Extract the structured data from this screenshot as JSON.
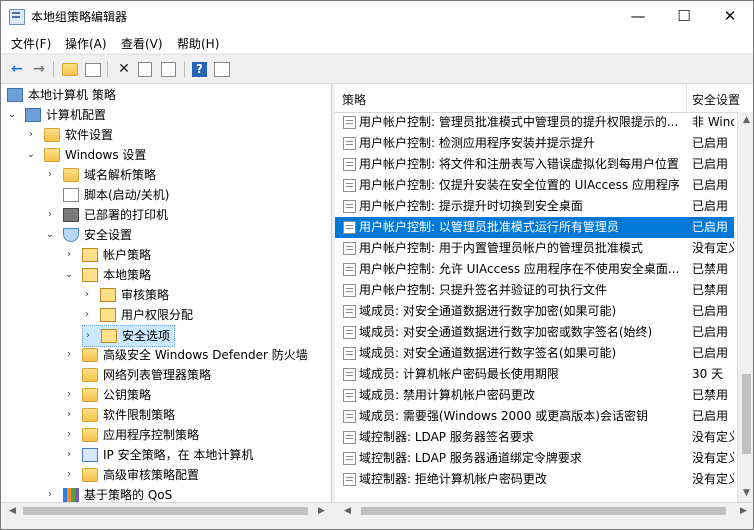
{
  "window": {
    "title": "本地组策略编辑器",
    "controls": [
      "—",
      "☐",
      "✕"
    ]
  },
  "menu": [
    {
      "label": "文件(F)"
    },
    {
      "label": "操作(A)"
    },
    {
      "label": "查看(V)"
    },
    {
      "label": "帮助(H)"
    }
  ],
  "toolbar": {
    "icons": [
      "back-icon",
      "forward-icon",
      "up-folder-icon",
      "show-hide-tree-icon",
      "delete-icon",
      "properties-icon",
      "export-list-icon",
      "help-icon",
      "console-tree-icon"
    ]
  },
  "tree": [
    {
      "label": "本地计算机 策略",
      "icon": "computer-icon"
    },
    {
      "label": "计算机配置",
      "icon": "computer-icon"
    },
    {
      "label": "软件设置",
      "icon": "folder-icon"
    },
    {
      "label": "Windows 设置",
      "icon": "folder-icon"
    },
    {
      "label": "域名解析策略",
      "icon": "folder-icon"
    },
    {
      "label": "脚本(启动/关机)",
      "icon": "script-icon"
    },
    {
      "label": "已部署的打印机",
      "icon": "printer-icon"
    },
    {
      "label": "安全设置",
      "icon": "security-icon"
    },
    {
      "label": "帐户策略",
      "icon": "lock-folder-icon"
    },
    {
      "label": "本地策略",
      "icon": "lock-folder-icon"
    },
    {
      "label": "审核策略",
      "icon": "lock-folder-icon"
    },
    {
      "label": "用户权限分配",
      "icon": "lock-folder-icon"
    },
    {
      "label": "安全选项",
      "icon": "lock-folder-icon"
    },
    {
      "label": "高级安全 Windows Defender 防火墙",
      "icon": "folder-icon"
    },
    {
      "label": "网络列表管理器策略",
      "icon": "folder-icon"
    },
    {
      "label": "公钥策略",
      "icon": "folder-icon"
    },
    {
      "label": "软件限制策略",
      "icon": "folder-icon"
    },
    {
      "label": "应用程序控制策略",
      "icon": "folder-icon"
    },
    {
      "label": "IP 安全策略，在 本地计算机",
      "icon": "ip-security-icon"
    },
    {
      "label": "高级审核策略配置",
      "icon": "folder-icon"
    },
    {
      "label": "基于策略的 QoS",
      "icon": "qos-chart-icon"
    }
  ],
  "columns": {
    "policy": "策略",
    "setting": "安全设置"
  },
  "policies": [
    {
      "name": "用户帐户控制: 管理员批准模式中管理员的提升权限提示的...",
      "setting": "非 Windows"
    },
    {
      "name": "用户帐户控制: 检测应用程序安装并提示提升",
      "setting": "已启用"
    },
    {
      "name": "用户帐户控制: 将文件和注册表写入错误虚拟化到每用户位置",
      "setting": "已启用"
    },
    {
      "name": "用户帐户控制: 仅提升安装在安全位置的 UIAccess 应用程序",
      "setting": "已启用"
    },
    {
      "name": "用户帐户控制: 提示提升时切换到安全桌面",
      "setting": "已启用"
    },
    {
      "name": "用户帐户控制: 以管理员批准模式运行所有管理员",
      "setting": "已启用"
    },
    {
      "name": "用户帐户控制: 用于内置管理员帐户的管理员批准模式",
      "setting": "没有定义"
    },
    {
      "name": "用户帐户控制: 允许 UIAccess 应用程序在不使用安全桌面...",
      "setting": "已禁用"
    },
    {
      "name": "用户帐户控制: 只提升签名并验证的可执行文件",
      "setting": "已禁用"
    },
    {
      "name": "域成员: 对安全通道数据进行数字加密(如果可能)",
      "setting": "已启用"
    },
    {
      "name": "域成员: 对安全通道数据进行数字加密或数字签名(始终)",
      "setting": "已启用"
    },
    {
      "name": "域成员: 对安全通道数据进行数字签名(如果可能)",
      "setting": "已启用"
    },
    {
      "name": "域成员: 计算机帐户密码最长使用期限",
      "setting": "30 天"
    },
    {
      "name": "域成员: 禁用计算机帐户密码更改",
      "setting": "已禁用"
    },
    {
      "name": "域成员: 需要强(Windows 2000 或更高版本)会话密钥",
      "setting": "已启用"
    },
    {
      "name": "域控制器: LDAP 服务器签名要求",
      "setting": "没有定义"
    },
    {
      "name": "域控制器: LDAP 服务器通道绑定令牌要求",
      "setting": "没有定义"
    },
    {
      "name": "域控制器: 拒绝计算机帐户密码更改",
      "setting": "没有定义"
    }
  ]
}
